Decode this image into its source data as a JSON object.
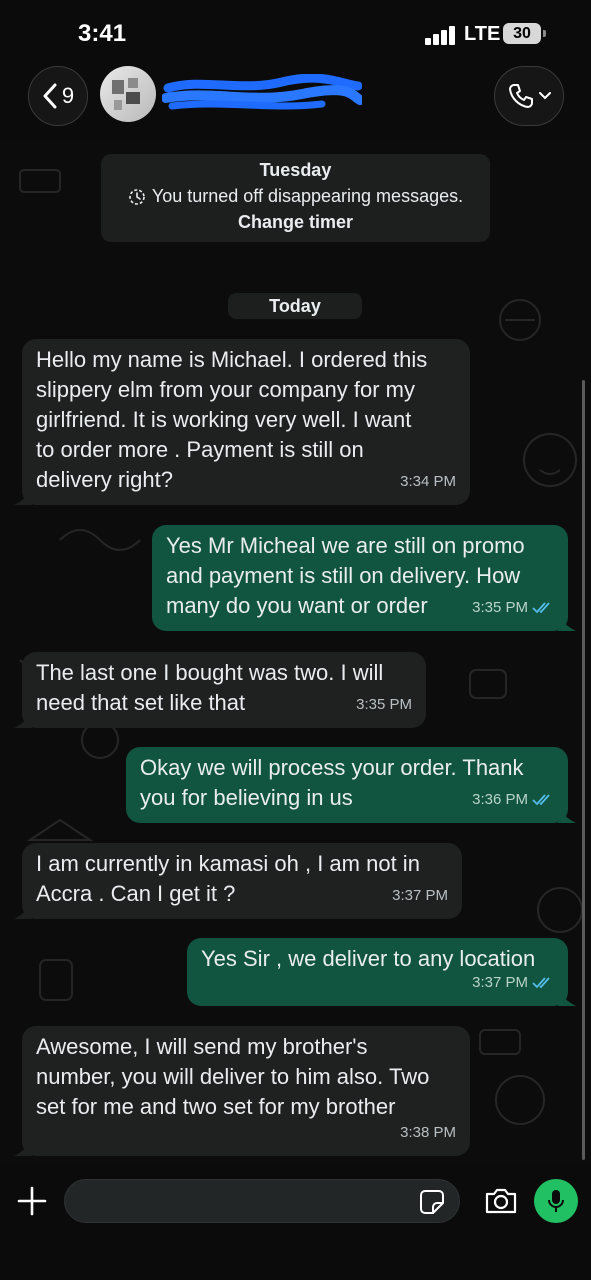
{
  "status_bar": {
    "time": "3:41",
    "network": "LTE",
    "battery": "30"
  },
  "header": {
    "back_count": "9",
    "contact_name": ""
  },
  "system": {
    "day_label": "Tuesday",
    "notice": "You turned off disappearing messages.",
    "action": "Change timer",
    "today_label": "Today"
  },
  "messages": [
    {
      "direction": "incoming",
      "text": "Hello my name is Michael. I ordered this\nslippery elm from your company for my\ngirlfriend. It is working very well. I want\nto order more . Payment is still on\ndelivery right?",
      "time": "3:34 PM"
    },
    {
      "direction": "outgoing",
      "text": "Yes Mr Micheal we are still on promo\nand payment is still on delivery. How\nmany do you want or order",
      "time": "3:35 PM",
      "status": "read"
    },
    {
      "direction": "incoming",
      "text": "The last one I bought was two. I will\nneed that set like that",
      "time": "3:35 PM"
    },
    {
      "direction": "outgoing",
      "text": "Okay we will process your order. Thank\nyou for believing in us",
      "time": "3:36 PM",
      "status": "read"
    },
    {
      "direction": "incoming",
      "text": "I am currently in kamasi oh , I am not in\nAccra . Can I get it ?",
      "time": "3:37 PM"
    },
    {
      "direction": "outgoing",
      "text": "Yes Sir , we deliver to any location",
      "time": "3:37 PM",
      "status": "read"
    },
    {
      "direction": "incoming",
      "text": "Awesome, I will send my brother's\nnumber, you will deliver to him also. Two\nset for me and two set for my brother",
      "time": "3:38 PM"
    }
  ],
  "composer": {
    "placeholder": ""
  },
  "colors": {
    "incoming_bubble": "#1f2020",
    "outgoing_bubble": "#11543f",
    "read_ticks": "#53bdeb",
    "mic_button": "#21c063"
  }
}
